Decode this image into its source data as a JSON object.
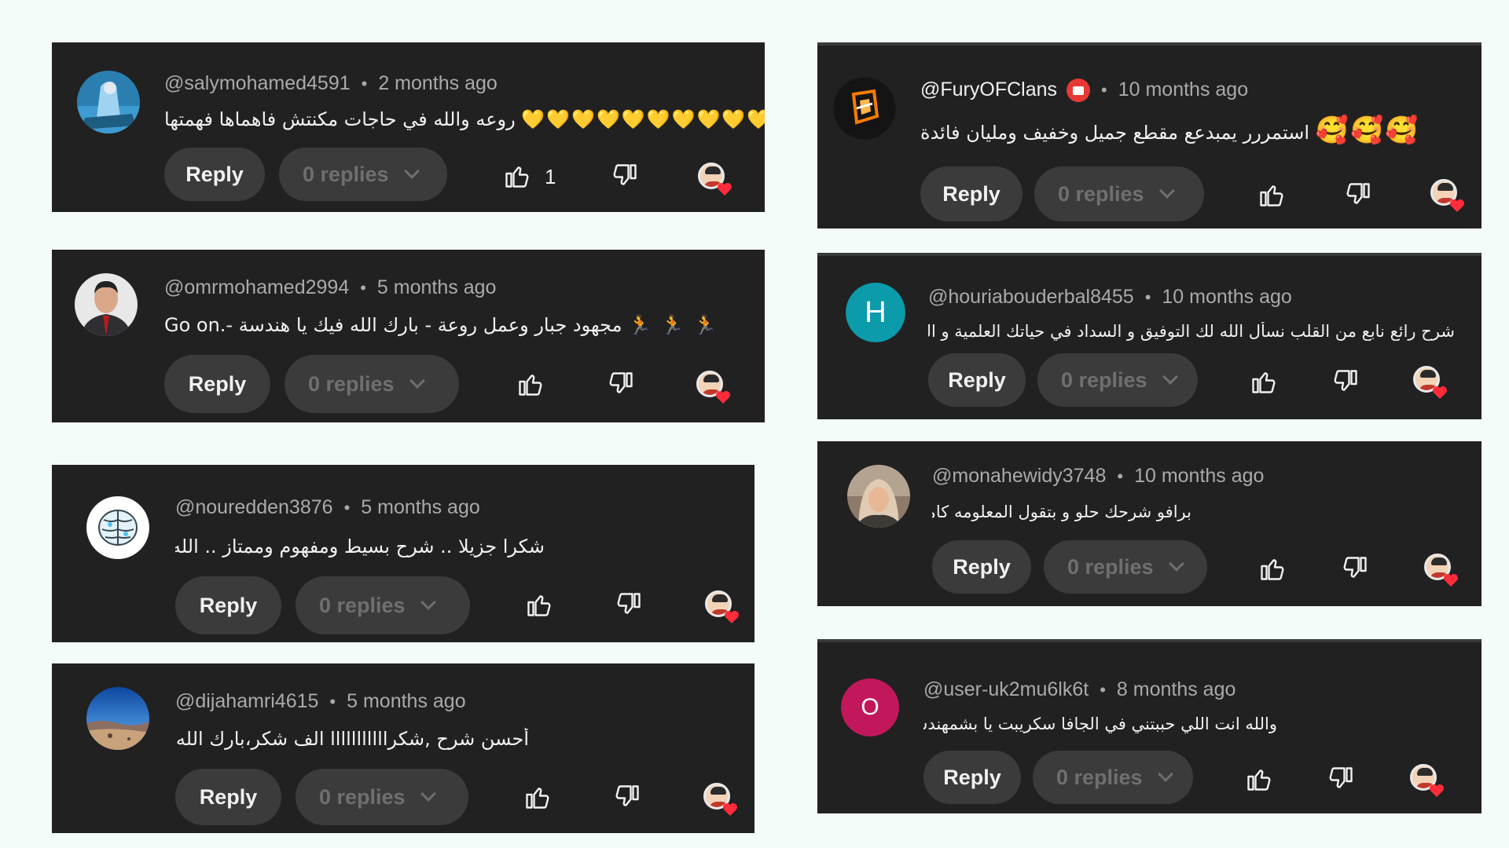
{
  "common": {
    "reply_label": "Reply",
    "replies_label": "0 replies",
    "dot": "•"
  },
  "comments": [
    {
      "handle": "@salymohamed4591",
      "time": "2 months ago",
      "text": "روعه والله في حاجات مكنتش فاهماها فهمتها",
      "emojis": "💛💛💛💛💛💛💛💛💛💛",
      "likes": "1",
      "avatar": "photo-blue"
    },
    {
      "handle": "@omrmohamed2994",
      "time": "5 months ago",
      "text": "Go on.- مجهود جبار وعمل روعة - بارك الله فيك يا هندسة",
      "emojis": "🏃 🏃 🏃",
      "avatar": "photo-man"
    },
    {
      "handle": "@nouredden3876",
      "time": "5 months ago",
      "text": "شكرا جزيلا .. شرح بسيط ومفهوم وممتاز .. الله يزيدك",
      "avatar": "brain"
    },
    {
      "handle": "@dijahamri4615",
      "time": "5 months ago",
      "text": "أحسن شرح ,شكرااااااااااا الف شكر،بارك الله فيك",
      "avatar": "landscape"
    },
    {
      "handle": "@FuryOFClans",
      "time": "10 months ago",
      "text": "استمررر يمبدعع مقطع جميل وخفيف ومليان فائدة",
      "emojis": "🥰🥰🥰",
      "avatar": "logo-orange"
    },
    {
      "handle": "@houriabouderbal8455",
      "time": "10 months ago",
      "text": "شرح رائع نابع من القلب نسأل الله لك التوفيق و السداد في حياتك العلمية و العملية",
      "avatar_letter": "H",
      "avatar_color": "#0b9bab"
    },
    {
      "handle": "@monahewidy3748",
      "time": "10 months ago",
      "text": "برافو شرحك حلو و بتقول المعلومه كامله",
      "avatar": "photo-woman"
    },
    {
      "handle": "@user-uk2mu6lk6t",
      "time": "8 months ago",
      "text": "والله انت اللي حببتني في الجافا سكريبت يا بشمهندس",
      "avatar_letter": "O",
      "avatar_color": "#c2185b"
    }
  ]
}
